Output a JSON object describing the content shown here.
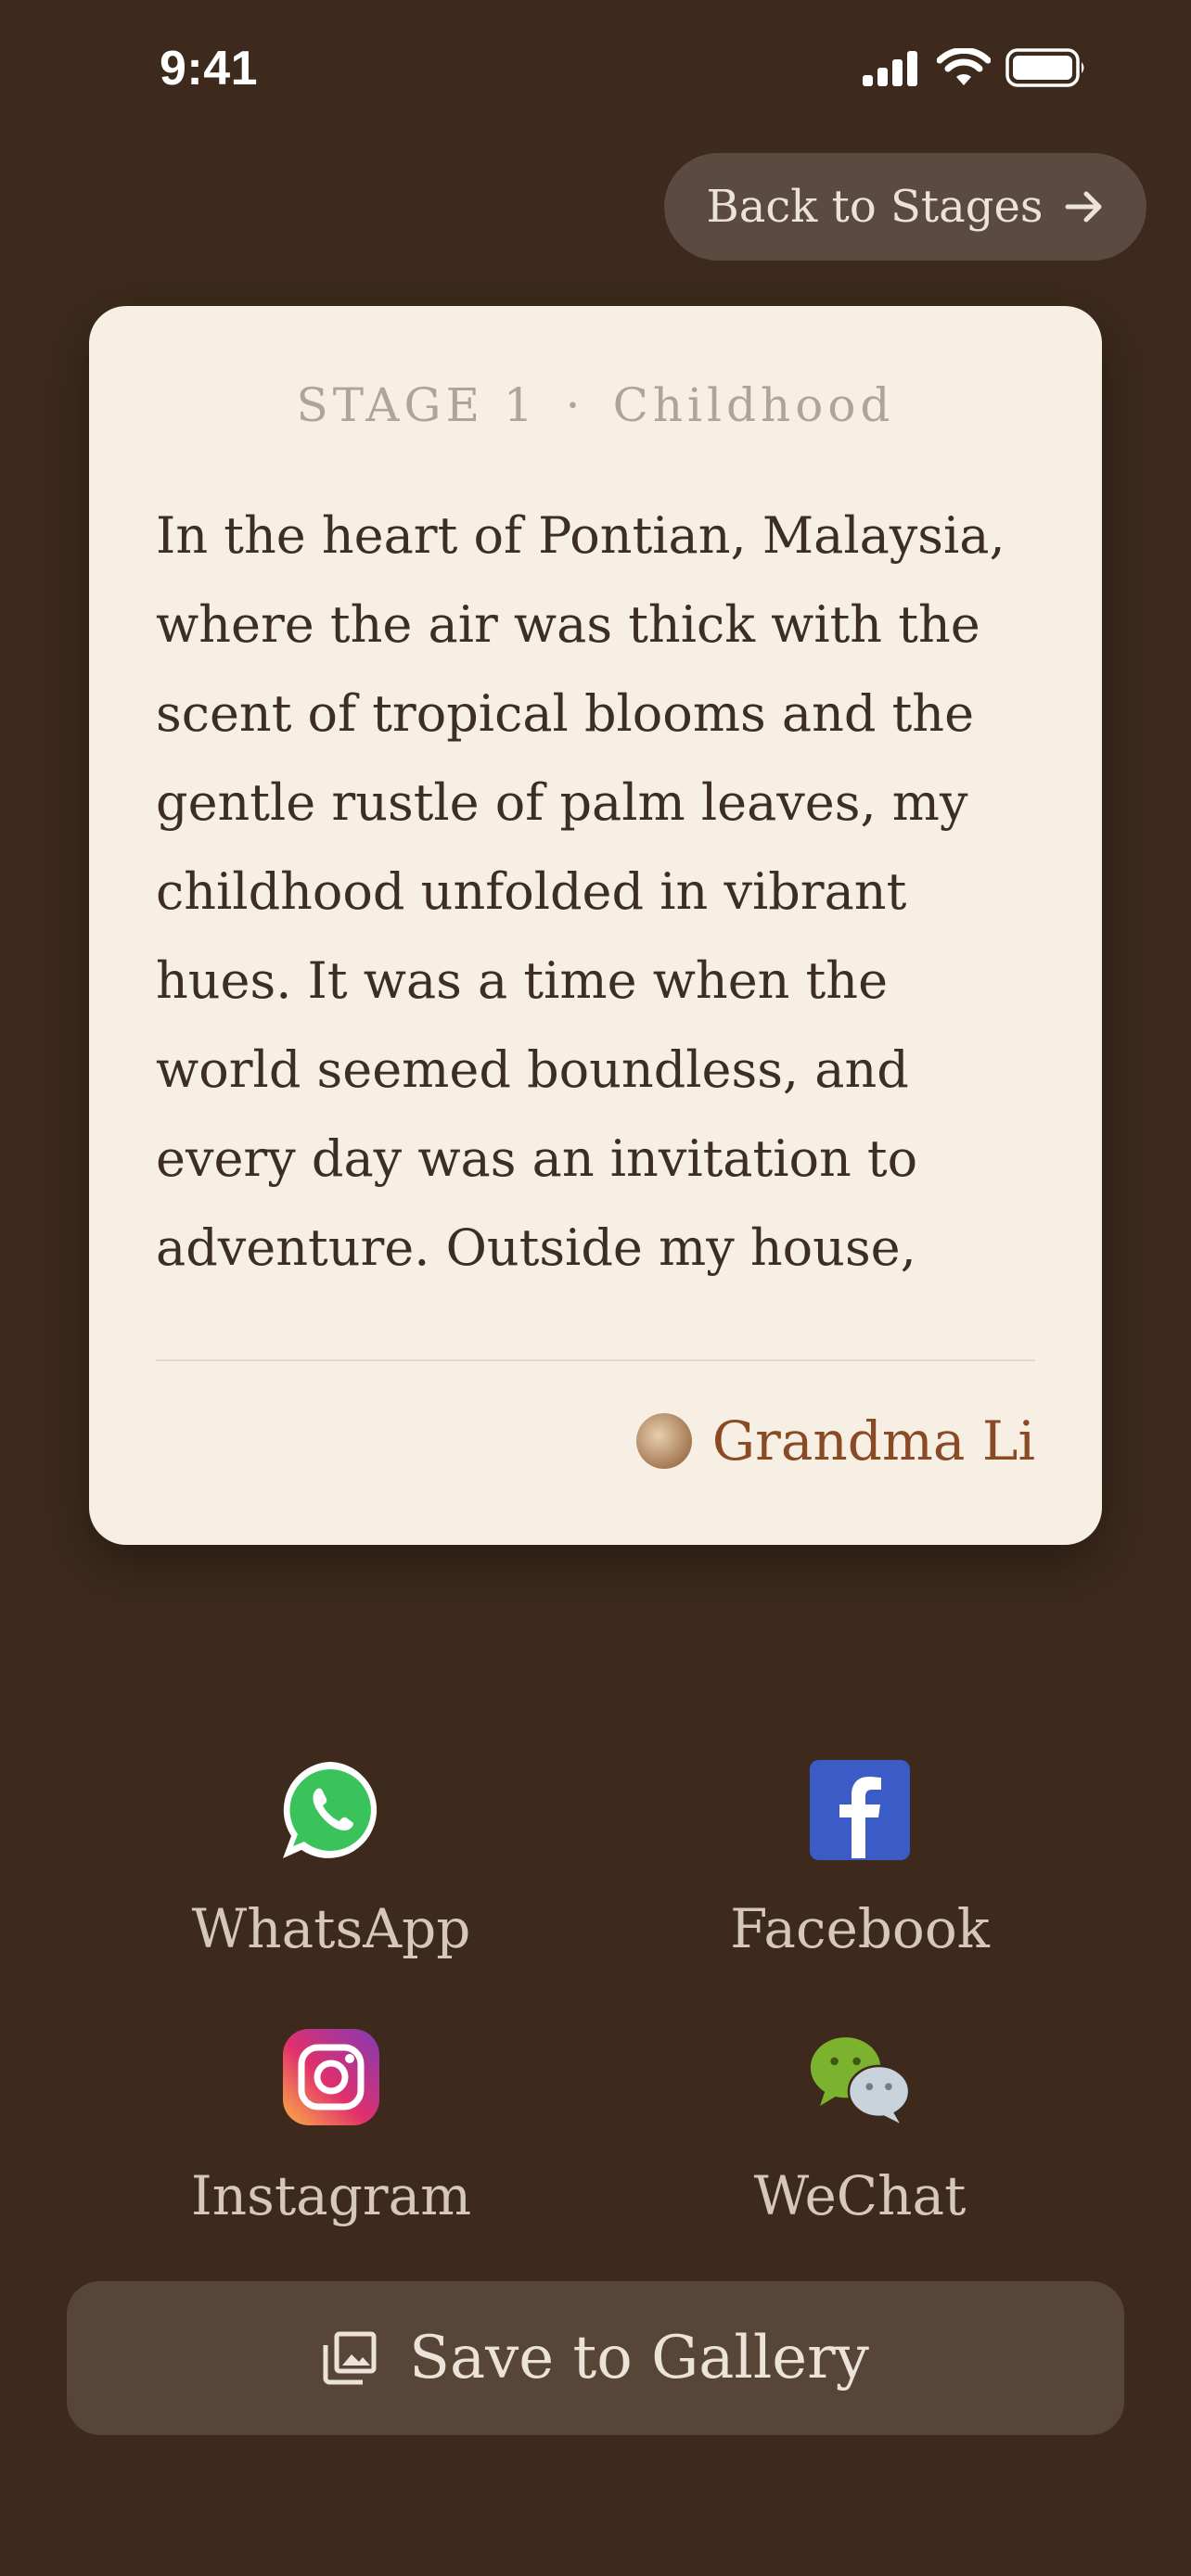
{
  "status_bar": {
    "time": "9:41"
  },
  "header": {
    "back_label": "Back to Stages"
  },
  "story": {
    "stage_label": "STAGE 1",
    "separator": "·",
    "stage_name": "Childhood",
    "text": "In the heart of Pontian, Malaysia, where the air was thick with the scent of tropical blooms and the gentle rustle of palm leaves, my childhood unfolded in vibrant hues. It was a time when the world seemed boundless, and every day was an invitation to adventure. Outside my house, there lay a",
    "author": "Grandma Li"
  },
  "share": [
    {
      "label": "WhatsApp",
      "icon": "whatsapp-icon",
      "color": "#25d366"
    },
    {
      "label": "Facebook",
      "icon": "facebook-icon",
      "color": "#3b5cc6"
    },
    {
      "label": "Instagram",
      "icon": "instagram-icon",
      "color": "#e1306c"
    },
    {
      "label": "WeChat",
      "icon": "wechat-icon",
      "color": "#7bb32e"
    }
  ],
  "save_label": "Save to Gallery",
  "colors": {
    "background": "#3d2a1c",
    "card": "#f7efe4",
    "author": "#8a4a24",
    "button": "#574638"
  }
}
